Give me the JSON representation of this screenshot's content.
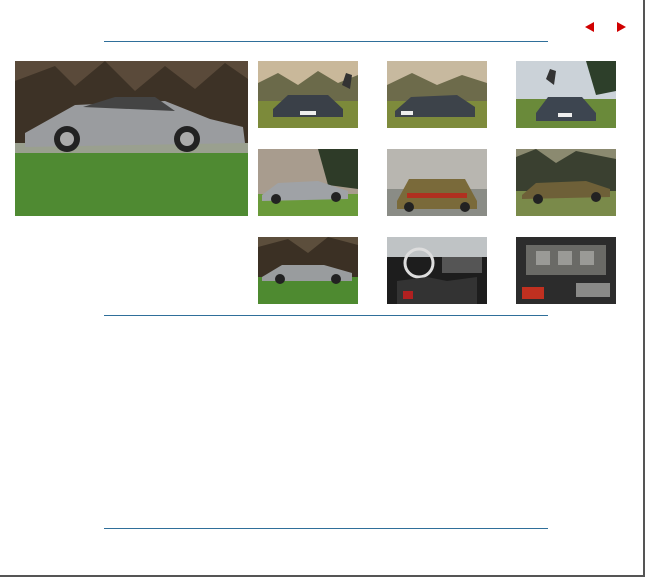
{
  "navigation": {
    "previous": "previous-arrow-icon",
    "next": "next-arrow-icon"
  },
  "colors": {
    "accent": "#d00000",
    "rule": "#2f6f9a",
    "frame": "#555555"
  },
  "gallery": {
    "main_photo": "car-side-view",
    "thumbnails": [
      "car-front-view-with-horse",
      "car-front-three-quarter-view",
      "car-rear-three-quarter-view",
      "car-side-three-quarter-view",
      "car-rear-view",
      "car-rear-side-view",
      "car-side-profile-view",
      "car-interior-dashboard",
      "car-engine-bay"
    ]
  }
}
